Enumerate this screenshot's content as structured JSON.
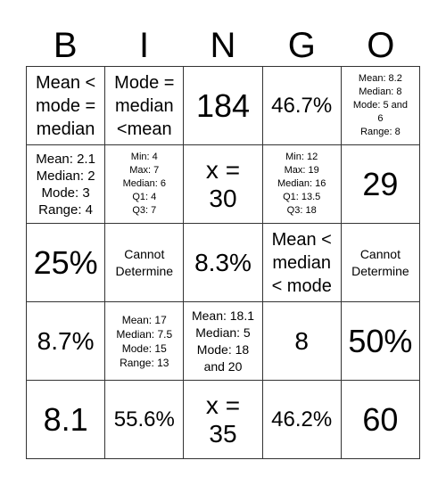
{
  "header": {
    "letters": [
      "B",
      "I",
      "N",
      "G",
      "O"
    ]
  },
  "board": {
    "rows": [
      [
        "Mean <\nmode =\nmedian",
        "Mode =\nmedian\n<mean",
        "184",
        "46.7%",
        "Mean: 8.2\nMedian: 8\nMode: 5 and\n6\nRange: 8"
      ],
      [
        "Mean: 2.1\nMedian: 2\nMode: 3\nRange: 4",
        "Min: 4\nMax: 7\nMedian: 6\nQ1: 4\nQ3: 7",
        "x =\n30",
        "Min: 12\nMax: 19\nMedian: 16\nQ1: 13.5\nQ3: 18",
        "29"
      ],
      [
        "25%",
        "Cannot\nDetermine",
        "8.3%",
        "Mean <\nmedian\n< mode",
        "Cannot\nDetermine"
      ],
      [
        "8.7%",
        "Mean: 17\nMedian: 7.5\nMode: 15\nRange: 13",
        "Mean: 18.1\nMedian: 5\nMode: 18\nand 20",
        "8",
        "50%"
      ],
      [
        "8.1",
        "55.6%",
        "x =\n35",
        "46.2%",
        "60"
      ]
    ]
  }
}
